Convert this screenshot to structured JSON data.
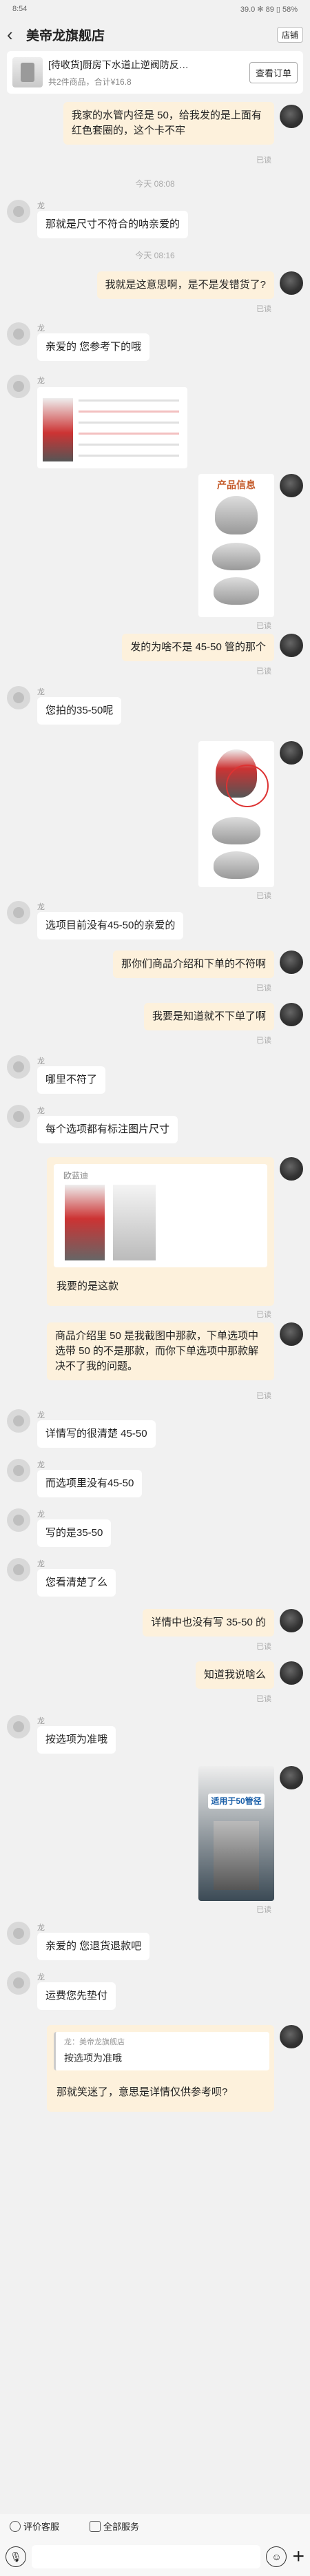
{
  "status": {
    "time": "8:54",
    "right": "39.0 ✻ 89 ▯ 58%"
  },
  "header": {
    "title": "美帝龙旗舰店",
    "store_btn": "店铺",
    "back": "‹",
    "more": "•••"
  },
  "order": {
    "title": "[待收货]厨房下水道止逆阀防反…",
    "sub": "共2件商品，合计¥16.8",
    "view": "查看订单"
  },
  "messages": {
    "m1": "我家的水管内径是 50，给我发的是上面有红色套圈的，这个卡不牢",
    "read": "已读",
    "t1": "今天 08:08",
    "m2": "那就是尺寸不符合的呐亲爱的",
    "t2": "今天 08:16",
    "m3": "我就是这意思啊，是不是发错货了?",
    "m4": "亲爱的 您参考下的哦",
    "img_title": "产品信息",
    "m5": "发的为啥不是 45-50 管的那个",
    "m6": "您拍的35-50呢",
    "m7": "选项目前没有45-50的亲爱的",
    "m8": "那你们商品介绍和下单的不符啊",
    "m9": "我要是知道就不下单了啊",
    "m10": "哪里不符了",
    "m11": "每个选项都有标注图片尺寸",
    "m12_quote_user": "欧蓝迪",
    "m12": "我要的是这款",
    "m13": "商品介绍里 50 是我截图中那款，下单选项中选带 50 的不是那款，而你下单选项中那款解决不了我的问题。",
    "m14": "详情写的很清楚 45-50",
    "m15": "而选项里没有45-50",
    "m16": "写的是35-50",
    "m17": "您看清楚了么",
    "m18": "详情中也没有写 35-50 的",
    "m19": "知道我说啥么",
    "m20": "按选项为准哦",
    "m21_img": "适用于50管径",
    "m22": "亲爱的 您退货退款吧",
    "m23": "运费您先垫付",
    "m24_quote_name": "龙：美帝龙旗舰店",
    "m24_quote": "按选项为准哦",
    "m24": "那就笑迷了，意思是详情仅供参考呗?",
    "sender": "龙"
  },
  "bottom": {
    "review": "评价客服",
    "all_service": "全部服务",
    "mic": "🎙",
    "emoji": "☺",
    "plus": "+"
  }
}
